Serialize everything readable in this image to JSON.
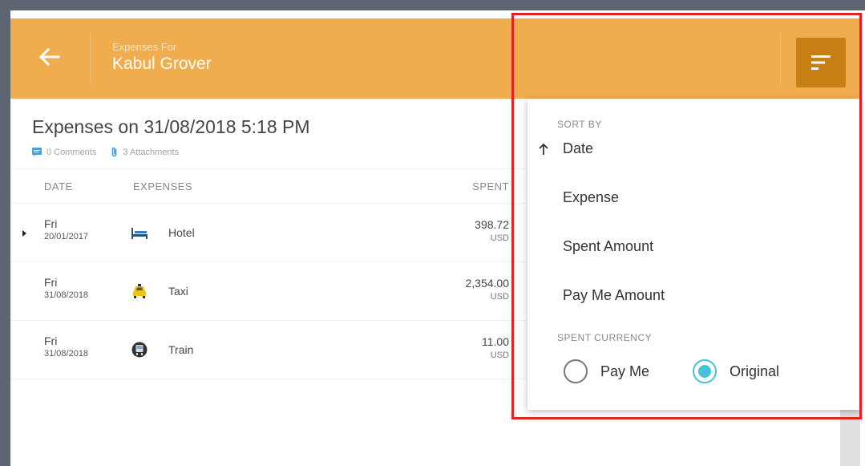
{
  "colors": {
    "header_bg": "#f0ad4e",
    "sort_button_bg": "#c87f14",
    "radio_accent": "#45c2d6",
    "highlight_border": "#e42226",
    "frame": "#5d6570"
  },
  "header": {
    "back_icon": "arrow-left-icon",
    "subtitle": "Expenses For",
    "title": "Kabul Grover",
    "sort_icon": "sort-lines-icon"
  },
  "report": {
    "title": "Expenses on 31/08/2018 5:18 PM",
    "comments_label": "0 Comments",
    "attachments_label": "3 Attachments"
  },
  "table": {
    "columns": {
      "date": "DATE",
      "expenses": "EXPENSES",
      "spent": "SPENT"
    },
    "rows": [
      {
        "day": "Fri",
        "date": "20/01/2017",
        "expense": "Hotel",
        "icon": "bed-icon",
        "amount": "398.72",
        "currency": "USD"
      },
      {
        "day": "Fri",
        "date": "31/08/2018",
        "expense": "Taxi",
        "icon": "taxi-icon",
        "amount": "2,354.00",
        "currency": "USD"
      },
      {
        "day": "Fri",
        "date": "31/08/2018",
        "expense": "Train",
        "icon": "train-icon",
        "amount": "11.00",
        "currency": "USD"
      }
    ]
  },
  "sort_menu": {
    "sort_by_heading": "SORT BY",
    "items": [
      "Date",
      "Expense",
      "Spent Amount",
      "Pay Me Amount"
    ],
    "active_item": "Date",
    "active_direction": "ascending",
    "currency_heading": "SPENT CURRENCY",
    "currency_options": [
      "Pay Me",
      "Original"
    ],
    "currency_selected": "Original"
  }
}
